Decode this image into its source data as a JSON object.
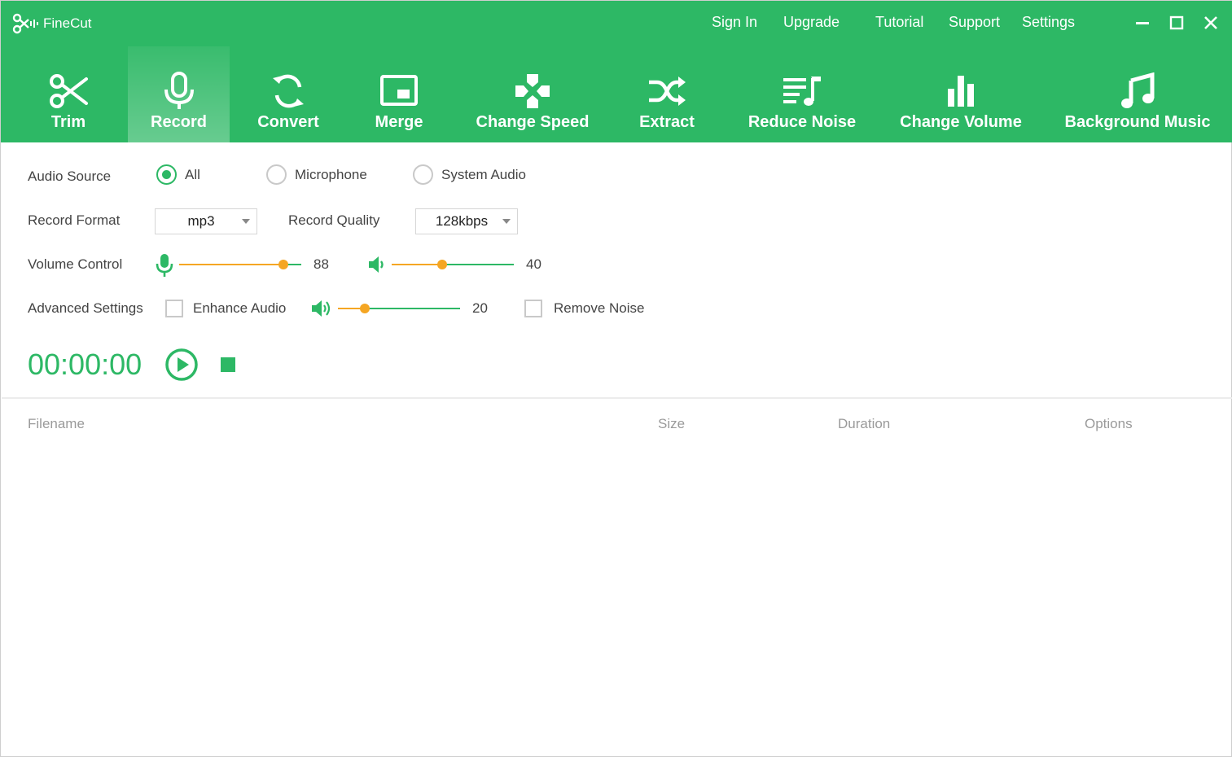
{
  "app": {
    "name": "FineCut",
    "brand_color": "#2db865",
    "accent_color": "#f5a623"
  },
  "top_links": [
    "Sign In",
    "Upgrade",
    "Tutorial",
    "Support",
    "Settings"
  ],
  "window_controls": [
    "minimize-icon",
    "maximize-icon",
    "close-icon"
  ],
  "tools": [
    {
      "label": "Trim",
      "icon": "scissors-icon",
      "active": false
    },
    {
      "label": "Record",
      "icon": "microphone-icon",
      "active": true
    },
    {
      "label": "Convert",
      "icon": "convert-icon",
      "active": false
    },
    {
      "label": "Merge",
      "icon": "merge-icon",
      "active": false
    },
    {
      "label": "Change Speed",
      "icon": "change-speed-icon",
      "active": false
    },
    {
      "label": "Extract",
      "icon": "extract-icon",
      "active": false
    },
    {
      "label": "Reduce Noise",
      "icon": "reduce-noise-icon",
      "active": false
    },
    {
      "label": "Change Volume",
      "icon": "change-volume-icon",
      "active": false
    },
    {
      "label": "Background Music",
      "icon": "music-note-icon",
      "active": false
    }
  ],
  "settings": {
    "audio_source": {
      "label": "Audio Source",
      "options": [
        "All",
        "Microphone",
        "System Audio"
      ],
      "selected": "All"
    },
    "record_format": {
      "label": "Record Format",
      "value": "mp3"
    },
    "record_quality": {
      "label": "Record Quality",
      "value": "128kbps"
    },
    "volume_control": {
      "label": "Volume Control",
      "microphone_value": "88",
      "microphone_level": 0.85,
      "speaker_value": "40",
      "speaker_level": 0.41
    },
    "advanced": {
      "label": "Advanced Settings",
      "enhance_audio_label": "Enhance Audio",
      "enhance_audio_checked": false,
      "enhance_value": "20",
      "enhance_level": 0.22,
      "remove_noise_label": "Remove Noise",
      "remove_noise_checked": false
    }
  },
  "recorder": {
    "timer": "00:00:00"
  },
  "file_list": {
    "columns": [
      "Filename",
      "Size",
      "Duration",
      "Options"
    ]
  }
}
